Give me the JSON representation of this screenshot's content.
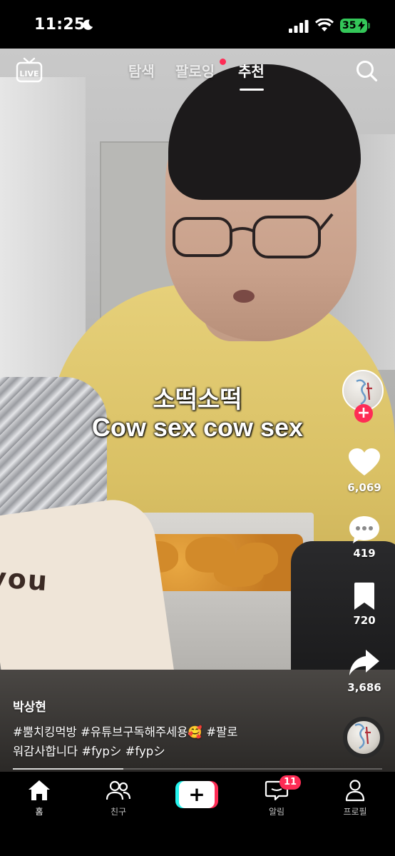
{
  "status_bar": {
    "time": "11:25",
    "battery": "35"
  },
  "top_nav": {
    "live_label": "LIVE",
    "tabs": [
      {
        "label": "탐색",
        "active": false
      },
      {
        "label": "팔로잉",
        "active": false,
        "has_dot": true
      },
      {
        "label": "추천",
        "active": true
      }
    ]
  },
  "captions": {
    "korean": "소떡소떡",
    "english": "Cow sex cow sex"
  },
  "right_rail": {
    "likes": "6,069",
    "comments": "419",
    "bookmarks": "720",
    "shares": "3,686"
  },
  "post": {
    "author": "박상현",
    "description_line1": "#뿜치킹먹방 #유튜브구독해주세용🥰 #팔로",
    "description_line2": "워감사합니다 #fypシ #fypシ",
    "progress": 0.3
  },
  "bottom_nav": {
    "items": [
      {
        "label": "홈",
        "icon": "home-icon",
        "active": true
      },
      {
        "label": "친구",
        "icon": "friends-icon",
        "active": false
      },
      {
        "label": "알림",
        "icon": "inbox-icon",
        "active": false,
        "badge": "11"
      },
      {
        "label": "프로필",
        "icon": "profile-icon",
        "active": false
      }
    ]
  },
  "colors": {
    "accent_red": "#fe2c55",
    "accent_cyan": "#25f4ee",
    "battery_green": "#34c759"
  }
}
